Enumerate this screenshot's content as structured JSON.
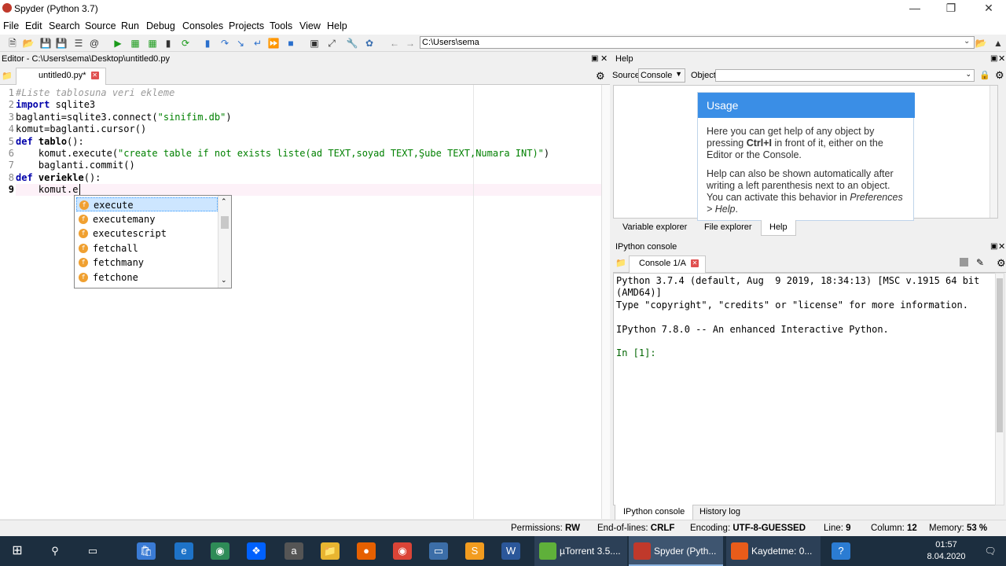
{
  "window": {
    "title": "Spyder (Python 3.7)"
  },
  "menu": [
    "File",
    "Edit",
    "Search",
    "Source",
    "Run",
    "Debug",
    "Consoles",
    "Projects",
    "Tools",
    "View",
    "Help"
  ],
  "toolbar": {
    "path": "C:\\Users\\sema"
  },
  "editor": {
    "header": "Editor - C:\\Users\\sema\\Desktop\\untitled0.py",
    "tab_label": "untitled0.py*",
    "lines": [
      {
        "n": "1",
        "parts": [
          {
            "c": "cm",
            "t": "#Liste tablosuna veri ekleme"
          }
        ]
      },
      {
        "n": "2",
        "parts": [
          {
            "c": "kw",
            "t": "import"
          },
          {
            "c": "",
            "t": " sqlite3"
          }
        ]
      },
      {
        "n": "3",
        "parts": [
          {
            "c": "",
            "t": "baglanti=sqlite3.connect("
          },
          {
            "c": "st",
            "t": "\"sinifim.db\""
          },
          {
            "c": "",
            "t": ")"
          }
        ]
      },
      {
        "n": "4",
        "parts": [
          {
            "c": "",
            "t": "komut=baglanti.cursor()"
          }
        ]
      },
      {
        "n": "5",
        "parts": [
          {
            "c": "kw",
            "t": "def"
          },
          {
            "c": "",
            "t": " "
          },
          {
            "c": "df",
            "t": "tablo"
          },
          {
            "c": "",
            "t": "():"
          }
        ]
      },
      {
        "n": "6",
        "parts": [
          {
            "c": "",
            "t": "    komut.execute("
          },
          {
            "c": "st",
            "t": "\"create table if not exists liste(ad TEXT,soyad TEXT,Şube TEXT,Numara INT)\""
          },
          {
            "c": "",
            "t": ")"
          }
        ]
      },
      {
        "n": "7",
        "parts": [
          {
            "c": "",
            "t": "    baglanti.commit()"
          }
        ]
      },
      {
        "n": "8",
        "parts": [
          {
            "c": "kw",
            "t": "def"
          },
          {
            "c": "",
            "t": " "
          },
          {
            "c": "df",
            "t": "veriekle"
          },
          {
            "c": "",
            "t": "():"
          }
        ]
      },
      {
        "n": "9",
        "parts": [
          {
            "c": "",
            "t": "    komut.e"
          }
        ]
      }
    ],
    "completion": [
      "execute",
      "executemany",
      "executescript",
      "fetchall",
      "fetchmany",
      "fetchone"
    ]
  },
  "help": {
    "header": "Help",
    "source_label": "Source",
    "source_value": "Console",
    "object_label": "Object",
    "usage_title": "Usage",
    "usage_p1_a": "Here you can get help of any object by pressing ",
    "usage_p1_b": "Ctrl+I",
    "usage_p1_c": " in front of it, either on the Editor or the Console.",
    "usage_p2_a": "Help can also be shown automatically after writing a left parenthesis next to an object. You can activate this behavior in ",
    "usage_p2_b": "Preferences > Help",
    "usage_p2_c": ".",
    "tabs": [
      "Variable explorer",
      "File explorer",
      "Help"
    ]
  },
  "console": {
    "header": "IPython console",
    "tab_label": "Console 1/A",
    "lines": [
      "Python 3.7.4 (default, Aug  9 2019, 18:34:13) [MSC v.1915 64 bit",
      "(AMD64)]",
      "Type \"copyright\", \"credits\" or \"license\" for more information.",
      "",
      "IPython 7.8.0 -- An enhanced Interactive Python.",
      "",
      "In [1]:"
    ],
    "tabs": [
      "IPython console",
      "History log"
    ]
  },
  "status": {
    "permissions_label": "Permissions:",
    "permissions": "RW",
    "eol_label": "End-of-lines:",
    "eol": "CRLF",
    "enc_label": "Encoding:",
    "enc": "UTF-8-GUESSED",
    "line_label": "Line:",
    "line": "9",
    "col_label": "Column:",
    "col": "12",
    "mem_label": "Memory:",
    "mem": "53 %"
  },
  "taskbar": {
    "apps": [
      {
        "label": "µTorrent 3.5....",
        "color": "#5fb03a"
      },
      {
        "label": "Spyder (Pyth...",
        "color": "#c0392b"
      },
      {
        "label": "Kaydetme: 0...",
        "color": "#e85c1a"
      }
    ],
    "time": "01:57",
    "date": "8.04.2020"
  }
}
